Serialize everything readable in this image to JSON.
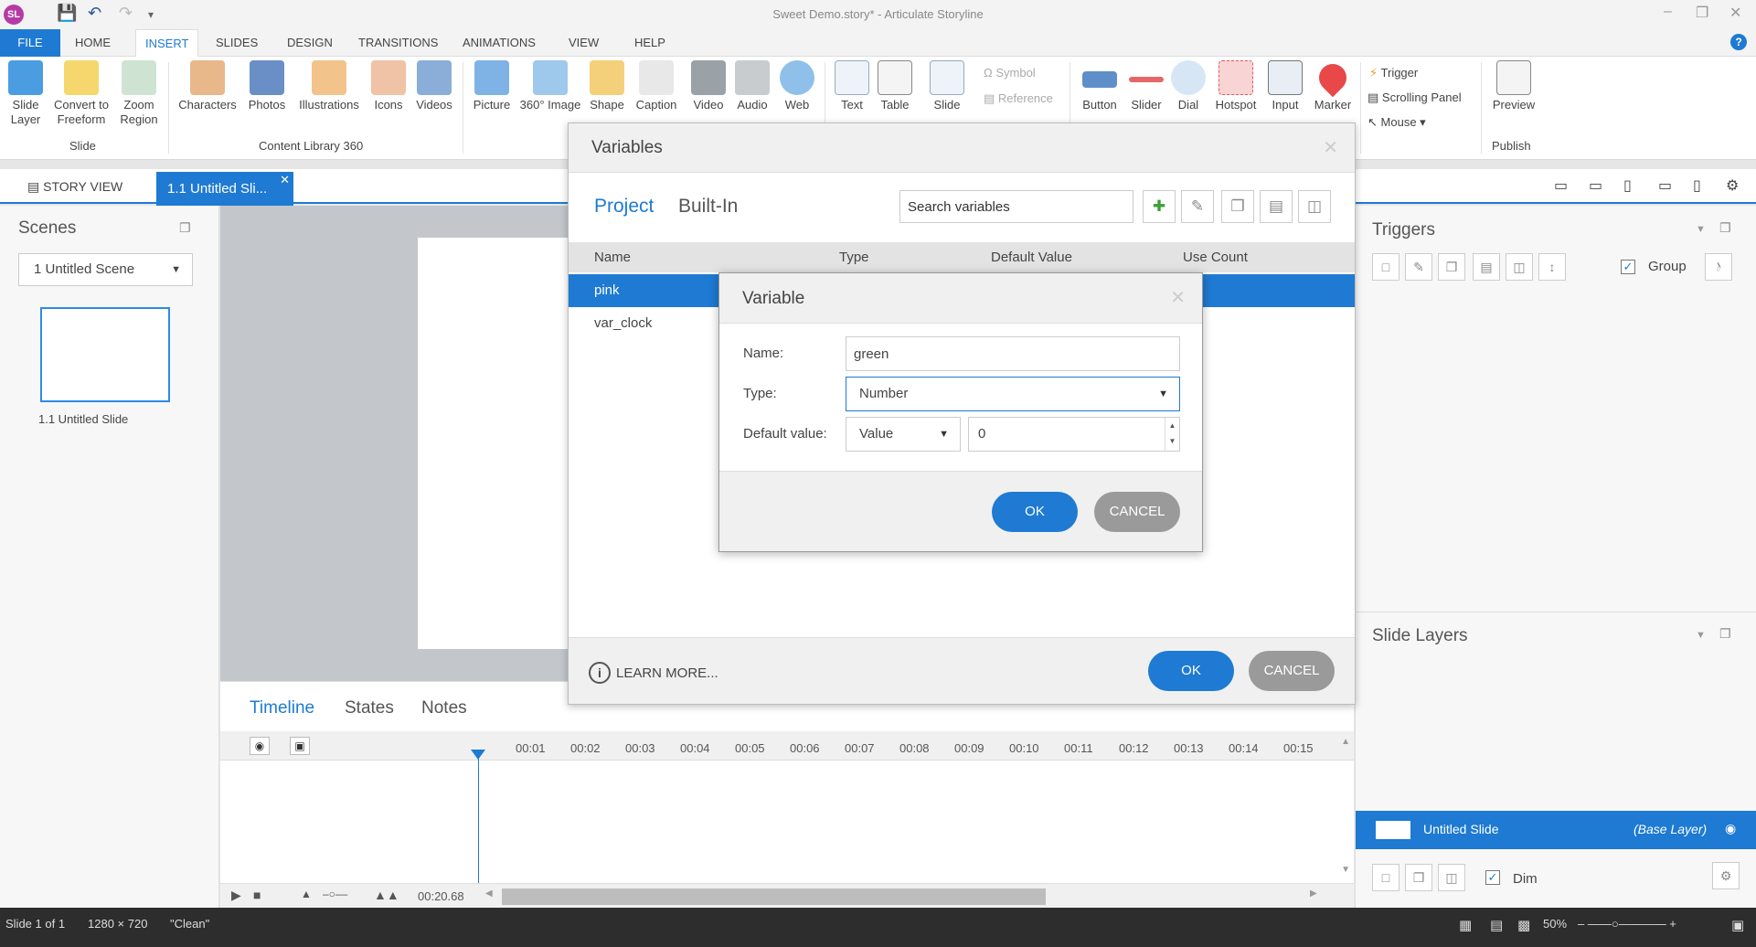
{
  "app": {
    "title": "Sweet Demo.story* - Articulate Storyline",
    "logo": "SL",
    "accent": "#1e7ad2"
  },
  "quick_access": [
    "save-icon",
    "undo-icon",
    "redo-icon",
    "customize-icon"
  ],
  "ribbon_tabs": [
    "FILE",
    "HOME",
    "INSERT",
    "SLIDES",
    "DESIGN",
    "TRANSITIONS",
    "ANIMATIONS",
    "VIEW",
    "HELP"
  ],
  "ribbon": {
    "slide_group": {
      "label": "Slide",
      "items": [
        {
          "line1": "Slide",
          "line2": "Layer"
        },
        {
          "line1": "Convert to",
          "line2": "Freeform"
        },
        {
          "line1": "Zoom",
          "line2": "Region"
        }
      ]
    },
    "content_library": {
      "label": "Content Library 360",
      "items": [
        "Characters",
        "Photos",
        "Illustrations",
        "Icons",
        "Videos"
      ]
    },
    "media_items": [
      "Picture",
      "360° Image",
      "Shape",
      "Caption",
      "Video",
      "Audio",
      "Web",
      "Text",
      "Table",
      "Slide"
    ],
    "small_items": [
      "Symbol",
      "Reference"
    ],
    "interactive_items": [
      "Button",
      "Slider",
      "Dial",
      "Hotspot",
      "Input",
      "Marker"
    ],
    "trigger_items": [
      "Trigger",
      "Scrolling Panel",
      "Mouse"
    ],
    "publish_group": {
      "label": "Publish",
      "item": "Preview"
    }
  },
  "doc_tabs": {
    "story_view": "STORY VIEW",
    "slide_tab": "1.1 Untitled Sli..."
  },
  "scenes": {
    "title": "Scenes",
    "selected_scene": "1 Untitled Scene",
    "thumb_label": "1.1 Untitled Slide"
  },
  "timeline": {
    "tabs": [
      "Timeline",
      "States",
      "Notes"
    ],
    "ticks": [
      "00:01",
      "00:02",
      "00:03",
      "00:04",
      "00:05",
      "00:06",
      "00:07",
      "00:08",
      "00:09",
      "00:10",
      "00:11",
      "00:12",
      "00:13",
      "00:14",
      "00:15"
    ],
    "duration": "00:20.68"
  },
  "triggers_panel": {
    "title": "Triggers",
    "group_label": "Group"
  },
  "layers_panel": {
    "title": "Slide Layers",
    "layer_name": "Untitled Slide",
    "layer_type": "(Base Layer)",
    "dim_label": "Dim"
  },
  "status": {
    "slide": "Slide 1 of 1",
    "size": "1280 × 720",
    "theme": "\"Clean\"",
    "zoom": "50%"
  },
  "variables_dialog": {
    "title": "Variables",
    "tabs": [
      "Project",
      "Built-In"
    ],
    "search_placeholder": "Search variables",
    "columns": [
      "Name",
      "Type",
      "Default Value",
      "Use Count"
    ],
    "rows": [
      {
        "name": "pink",
        "selected": true
      },
      {
        "name": "var_clock",
        "selected": false
      }
    ],
    "learn_more": "LEARN MORE...",
    "ok": "OK",
    "cancel": "CANCEL"
  },
  "variable_dialog": {
    "title": "Variable",
    "name_label": "Name:",
    "name_value": "green",
    "type_label": "Type:",
    "type_value": "Number",
    "default_label": "Default value:",
    "default_mode": "Value",
    "default_value": "0",
    "ok": "OK",
    "cancel": "CANCEL"
  }
}
